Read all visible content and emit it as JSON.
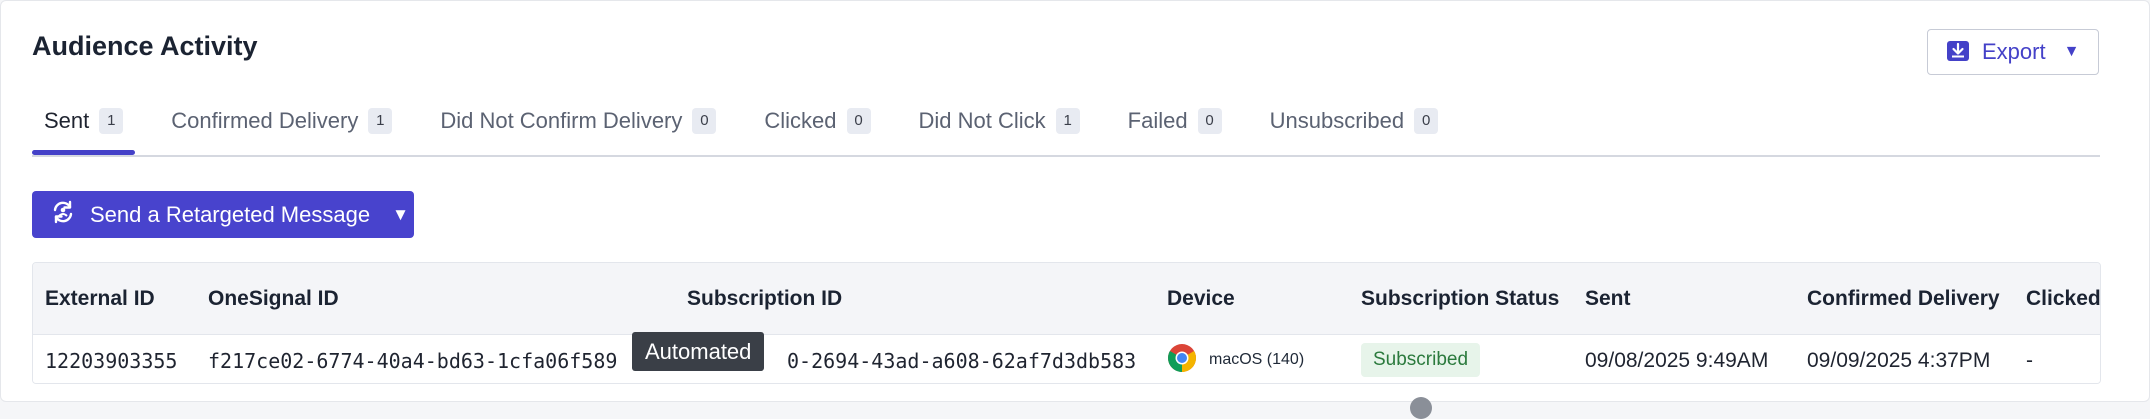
{
  "panel": {
    "title": "Audience Activity",
    "export_label": "Export"
  },
  "tabs": [
    {
      "label": "Sent",
      "count": "1",
      "active": true
    },
    {
      "label": "Confirmed Delivery",
      "count": "1"
    },
    {
      "label": "Did Not Confirm Delivery",
      "count": "0"
    },
    {
      "label": "Clicked",
      "count": "0"
    },
    {
      "label": "Did Not Click",
      "count": "1"
    },
    {
      "label": "Failed",
      "count": "0"
    },
    {
      "label": "Unsubscribed",
      "count": "0"
    }
  ],
  "retarget": {
    "label": "Send a Retargeted Message"
  },
  "table": {
    "headers": {
      "external_id": "External ID",
      "onesignal_id": "OneSignal ID",
      "subscription_id": "Subscription ID",
      "device": "Device",
      "subscription_status": "Subscription Status",
      "sent": "Sent",
      "confirmed_delivery": "Confirmed Delivery",
      "clicked": "Clicked"
    },
    "rows": [
      {
        "external_id": "12203903355",
        "onesignal_id": "f217ce02-6774-40a4-bd63-1cfa06f589",
        "subscription_id": "0-2694-43ad-a608-62af7d3db583",
        "device": "macOS (140)",
        "subscription_status": "Subscribed",
        "sent": "09/08/2025 9:49AM",
        "confirmed_delivery": "09/09/2025 4:37PM",
        "clicked": "-"
      }
    ]
  },
  "tooltip": {
    "text": "Automated"
  },
  "colors": {
    "accent": "#4843cd",
    "badge_bg": "#e7f4ea",
    "badge_text": "#2b7a3d"
  },
  "icons": {
    "export": "download-icon",
    "retarget": "refresh-icon",
    "device": "chrome-icon"
  }
}
